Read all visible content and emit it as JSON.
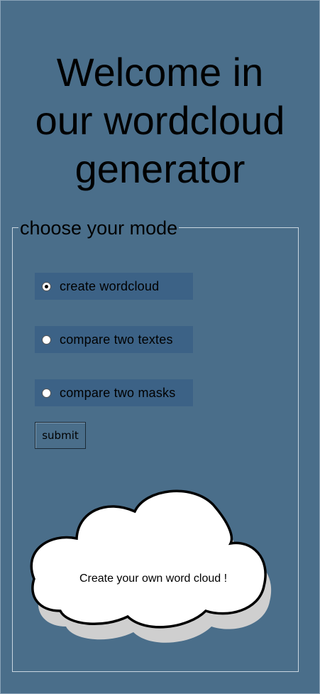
{
  "header": {
    "title_line1": "Welcome in",
    "title_line2": "our wordcloud",
    "title_line3": "generator"
  },
  "mode_group": {
    "legend": "choose your mode",
    "options": [
      {
        "label": "create wordcloud",
        "checked": true
      },
      {
        "label": "compare two textes",
        "checked": false
      },
      {
        "label": "compare two masks",
        "checked": false
      }
    ],
    "submit_label": "submit"
  },
  "cloud": {
    "caption": "Create your own word cloud !"
  },
  "colors": {
    "background": "#4a6e8a",
    "radio_row": "#3c6286",
    "cloud_fill": "#ffffff",
    "cloud_shadow": "#cfcfcf"
  }
}
